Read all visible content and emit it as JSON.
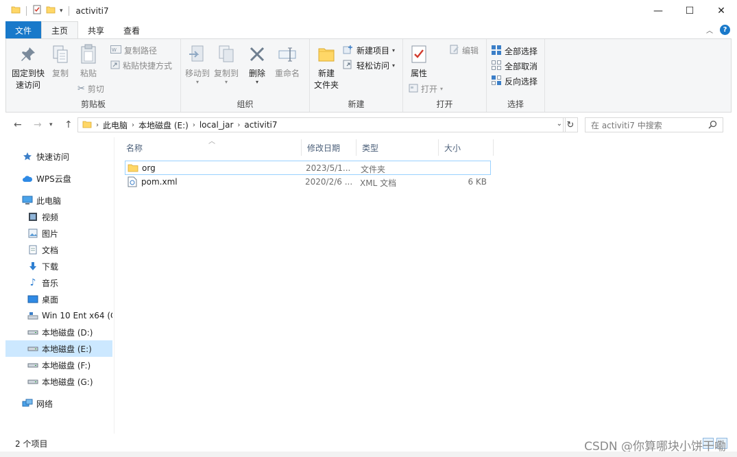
{
  "window": {
    "title": "activiti7",
    "controls": {
      "minimize": "—",
      "maximize": "☐",
      "close": "✕"
    }
  },
  "ribbon_tabs": [
    {
      "label": "文件"
    },
    {
      "label": "主页"
    },
    {
      "label": "共享"
    },
    {
      "label": "查看"
    }
  ],
  "ribbon": {
    "clipboard": {
      "label": "剪贴板",
      "pin": "固定到快速访问",
      "pin_line1": "固定到快",
      "pin_line2": "速访问",
      "copy": "复制",
      "paste": "粘贴",
      "copy_path": "复制路径",
      "paste_shortcut": "粘贴快捷方式",
      "cut": "剪切"
    },
    "organize": {
      "label": "组织",
      "move_to": "移动到",
      "copy_to": "复制到",
      "delete": "删除",
      "rename": "重命名"
    },
    "new": {
      "label": "新建",
      "new_folder_line1": "新建",
      "new_folder_line2": "文件夹",
      "new_item": "新建项目",
      "easy_access": "轻松访问"
    },
    "open": {
      "label": "打开",
      "properties": "属性",
      "open": "打开",
      "edit": "编辑"
    },
    "select": {
      "label": "选择",
      "select_all": "全部选择",
      "select_none": "全部取消",
      "invert": "反向选择"
    }
  },
  "address": {
    "crumbs": [
      "此电脑",
      "本地磁盘 (E:)",
      "local_jar",
      "activiti7"
    ],
    "search_placeholder": "在 activiti7 中搜索"
  },
  "nav": {
    "items": [
      {
        "label": "快速访问",
        "icon": "star-icon"
      },
      {
        "label": "WPS云盘",
        "icon": "cloud-icon"
      },
      {
        "label": "此电脑",
        "icon": "computer-icon"
      },
      {
        "label": "视频",
        "icon": "video-icon"
      },
      {
        "label": "图片",
        "icon": "picture-icon"
      },
      {
        "label": "文档",
        "icon": "document-icon"
      },
      {
        "label": "下载",
        "icon": "download-icon"
      },
      {
        "label": "音乐",
        "icon": "music-icon"
      },
      {
        "label": "桌面",
        "icon": "desktop-icon"
      },
      {
        "label": "Win 10 Ent x64 (C",
        "icon": "system-drive-icon"
      },
      {
        "label": "本地磁盘 (D:)",
        "icon": "drive-icon"
      },
      {
        "label": "本地磁盘 (E:)",
        "icon": "drive-icon"
      },
      {
        "label": "本地磁盘 (F:)",
        "icon": "drive-icon"
      },
      {
        "label": "本地磁盘 (G:)",
        "icon": "drive-icon"
      },
      {
        "label": "网络",
        "icon": "network-icon"
      }
    ]
  },
  "columns": {
    "name": "名称",
    "date": "修改日期",
    "type": "类型",
    "size": "大小"
  },
  "files": [
    {
      "name": "org",
      "date": "2023/5/1...",
      "type": "文件夹",
      "size": "",
      "icon": "folder-icon"
    },
    {
      "name": "pom.xml",
      "date": "2020/2/6 ...",
      "type": "XML 文档",
      "size": "6 KB",
      "icon": "xml-file-icon"
    }
  ],
  "status": {
    "count": "2 个项目"
  },
  "watermark": "CSDN @你算哪块小饼干嘞",
  "colors": {
    "accent": "#1979ca",
    "selection": "#cce8ff",
    "folder": "#ffd767"
  }
}
